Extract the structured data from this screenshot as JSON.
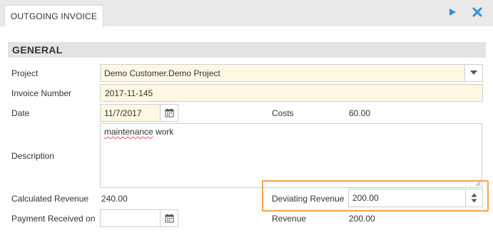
{
  "tab": {
    "title": "OUTGOING INVOICE"
  },
  "toolbar": {
    "run_icon": "play-icon",
    "close_icon": "close-icon",
    "accent_color": "#2b8ee0"
  },
  "section": {
    "title": "GENERAL"
  },
  "form": {
    "project": {
      "label": "Project",
      "value": "Demo Customer.Demo Project"
    },
    "invoice_number": {
      "label": "Invoice Number",
      "value": "2017-11-145"
    },
    "date": {
      "label": "Date",
      "value": "11/7/2017"
    },
    "costs": {
      "label": "Costs",
      "value": "60.00"
    },
    "description": {
      "label": "Description",
      "value_word1": "maintenance",
      "value_word2": "work"
    },
    "calculated_revenue": {
      "label": "Calculated Revenue",
      "value": "240.00"
    },
    "deviating_revenue": {
      "label": "Deviating Revenue",
      "value": "200.00"
    },
    "payment_received_on": {
      "label": "Payment Received on",
      "value": ""
    },
    "revenue": {
      "label": "Revenue",
      "value": "200.00"
    }
  },
  "colors": {
    "required_field_bg": "#fdf7e3",
    "highlight_border": "#f4a34a",
    "section_bg": "#e3e3e3"
  }
}
